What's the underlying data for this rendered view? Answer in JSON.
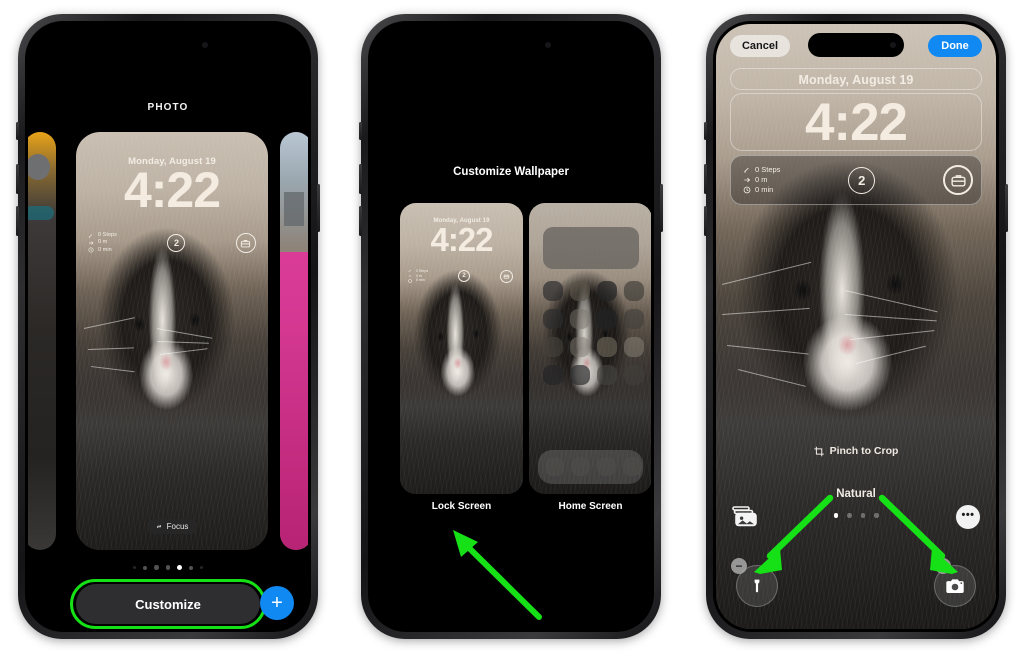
{
  "background_color": "#ffffff",
  "accent_colors": {
    "ios_blue": "#1189f3",
    "annotation_green": "#16e016",
    "panel_dark": "#2e2e30"
  },
  "panels": [
    {
      "id": "panel-1",
      "name": "lock-screen-switcher",
      "header_label": "PHOTO",
      "lock_screen": {
        "date": "Monday, August 19",
        "time": "4:22",
        "activity_widget": {
          "steps": "0  Steps",
          "distance": "0  m",
          "minutes": "0  min"
        },
        "circle_widget_value": "2",
        "briefcase_widget_name": "briefcase-icon",
        "focus_pill_label": "Focus"
      },
      "page_dots": {
        "count": 7,
        "active_index": 4
      },
      "customize_button_label": "Customize",
      "add_button_label": "+",
      "annotation": "green-highlight-ring-around-customize"
    },
    {
      "id": "panel-2",
      "name": "customize-wallpaper-chooser",
      "title": "Customize Wallpaper",
      "previews": [
        {
          "label": "Lock Screen",
          "date": "Monday, August 19",
          "time": "4:22",
          "activity_widget": {
            "steps": "0 Steps",
            "distance": "0 m",
            "minutes": "0 min"
          },
          "circle_widget_value": "2"
        },
        {
          "label": "Home Screen"
        }
      ],
      "annotation": "green-arrow-pointing-to-lock-screen"
    },
    {
      "id": "panel-3",
      "name": "lock-screen-editor",
      "topbar": {
        "cancel_label": "Cancel",
        "done_label": "Done"
      },
      "date": "Monday, August 19",
      "time": "4:22",
      "activity_widget": {
        "steps": "0  Steps",
        "distance": "0  m",
        "minutes": "0  min"
      },
      "circle_widget_value": "2",
      "briefcase_widget_name": "briefcase-icon",
      "pinch_hint": "Pinch to Crop",
      "style_name": "Natural",
      "style_dots": {
        "count": 4,
        "active_index": 0
      },
      "photos_picker_name": "photos-library-icon",
      "more_options_label": "•••",
      "quick_actions": [
        {
          "name": "flashlight-button",
          "badge": "−"
        },
        {
          "name": "camera-button",
          "badge": "−"
        }
      ],
      "annotation": "two-green-arrows-pointing-to-quick-action-buttons"
    }
  ]
}
